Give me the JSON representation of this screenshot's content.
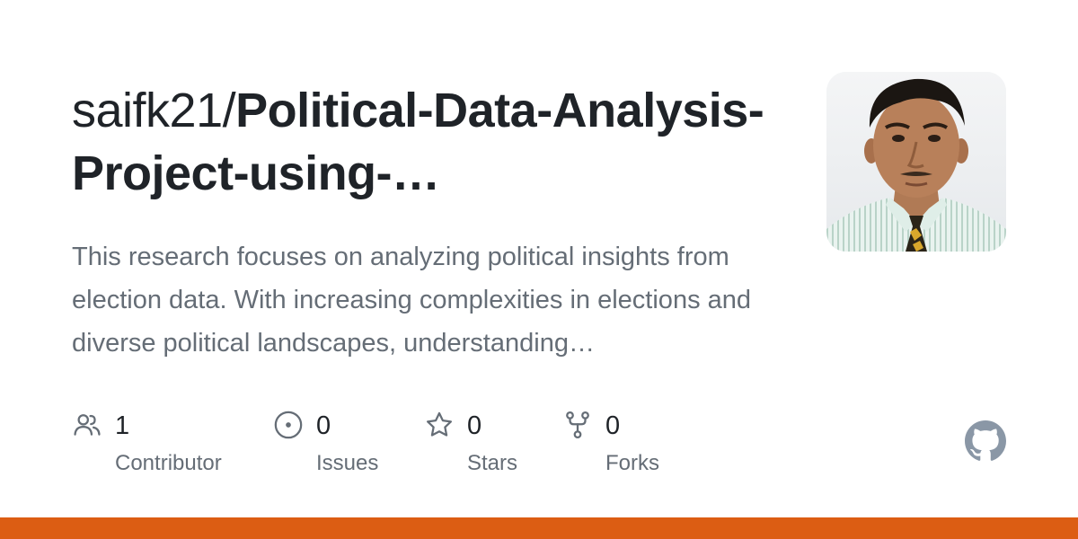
{
  "repo": {
    "owner": "saifk21/",
    "name": "Political-Data-Analysis-Project-using-…",
    "description": "This research focuses on analyzing political insights from election data. With increasing complexities in elections and diverse political landscapes, understanding…"
  },
  "stats": [
    {
      "icon": "people-icon",
      "count": "1",
      "label": "Contributor"
    },
    {
      "icon": "issue-opened-icon",
      "count": "0",
      "label": "Issues"
    },
    {
      "icon": "star-icon",
      "count": "0",
      "label": "Stars"
    },
    {
      "icon": "repo-forked-icon",
      "count": "0",
      "label": "Forks"
    }
  ],
  "brand": {
    "logo": "github-mark-icon",
    "accent_bar_color": "#dc5d13",
    "logo_color": "#8a97a6"
  }
}
